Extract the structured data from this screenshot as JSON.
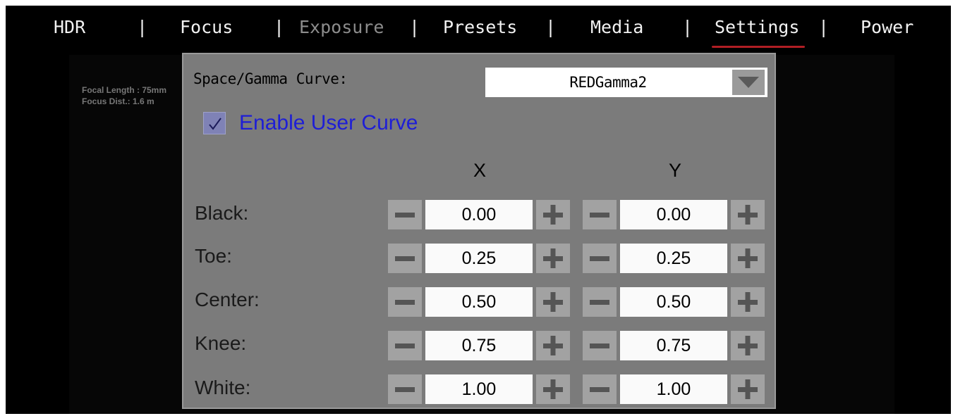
{
  "menu": {
    "items": [
      {
        "label": "HDR",
        "state": "normal"
      },
      {
        "label": "Focus",
        "state": "normal"
      },
      {
        "label": "Exposure",
        "state": "disabled"
      },
      {
        "label": "Presets",
        "state": "normal"
      },
      {
        "label": "Media",
        "state": "normal"
      },
      {
        "label": "Settings",
        "state": "active"
      },
      {
        "label": "Power",
        "state": "normal"
      }
    ],
    "separator": "|"
  },
  "background_info": {
    "focal_length": "Focal Length : 75mm",
    "focus_dist": "Focus Dist.: 1.6 m"
  },
  "gamma_panel": {
    "curve_label": "Space/Gamma Curve:",
    "curve_value": "REDGamma2",
    "enable_user_curve": {
      "label": "Enable User Curve",
      "checked": true
    },
    "col_x": "X",
    "col_y": "Y",
    "rows": [
      {
        "label": "Black:",
        "x": "0.00",
        "y": "0.00"
      },
      {
        "label": "Toe:",
        "x": "0.25",
        "y": "0.25"
      },
      {
        "label": "Center:",
        "x": "0.50",
        "y": "0.50"
      },
      {
        "label": "Knee:",
        "x": "0.75",
        "y": "0.75"
      },
      {
        "label": "White:",
        "x": "1.00",
        "y": "1.00"
      }
    ]
  },
  "icons": {
    "dropdown": "triangle-down-icon",
    "checkbox": "checkmark-icon",
    "decrement": "minus-icon",
    "increment": "plus-icon"
  },
  "colors": {
    "active_underline": "#b01e24",
    "panel_bg": "#7b7b7b",
    "checkbox_label": "#1e1ed6",
    "disabled_menu": "#8c8c8c"
  }
}
